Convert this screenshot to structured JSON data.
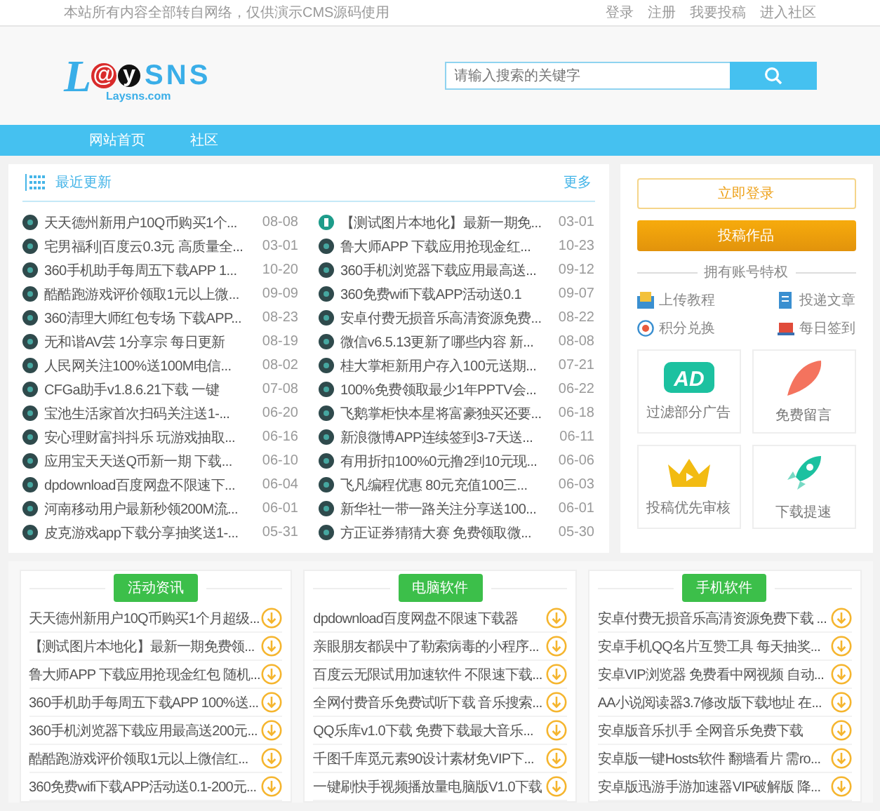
{
  "topbar": {
    "notice": "本站所有内容全部转自网络，仅供演示CMS源码使用",
    "links": [
      "登录",
      "注册",
      "我要投稿",
      "进入社区"
    ]
  },
  "logo": {
    "mark": [
      "L",
      "@",
      "y"
    ],
    "name": "SNS",
    "domain": "Laysns.com"
  },
  "search": {
    "placeholder": "请输入搜索的关键字"
  },
  "nav": [
    "网站首页",
    "社区"
  ],
  "recent": {
    "title": "最近更新",
    "more": "更多",
    "items": [
      {
        "title": "天天德州新用户10Q币购买1个...",
        "date": "08-08",
        "kind": "dot"
      },
      {
        "title": "【测试图片本地化】最新一期免...",
        "date": "03-01",
        "kind": "image"
      },
      {
        "title": "宅男福利|百度云0.3元 高质量全...",
        "date": "03-01",
        "kind": "dot"
      },
      {
        "title": "鲁大师APP 下载应用抢现金红...",
        "date": "10-23",
        "kind": "dot"
      },
      {
        "title": "360手机助手每周五下载APP 1...",
        "date": "10-20",
        "kind": "dot"
      },
      {
        "title": "360手机浏览器下载应用最高送...",
        "date": "09-12",
        "kind": "dot"
      },
      {
        "title": "酷酷跑游戏评价领取1元以上微...",
        "date": "09-09",
        "kind": "dot"
      },
      {
        "title": "360免费wifi下载APP活动送0.1",
        "date": "09-07",
        "kind": "dot"
      },
      {
        "title": "360清理大师红包专场 下载APP...",
        "date": "08-23",
        "kind": "dot"
      },
      {
        "title": "安卓付费无损音乐高清资源免费...",
        "date": "08-22",
        "kind": "dot"
      },
      {
        "title": "无和谐AV芸 1分享宗 每日更新",
        "date": "08-19",
        "kind": "dot"
      },
      {
        "title": "微信v6.5.13更新了哪些内容 新...",
        "date": "08-08",
        "kind": "dot"
      },
      {
        "title": "人民网关注100%送100M电信...",
        "date": "08-02",
        "kind": "dot"
      },
      {
        "title": "桂大掌柜新用户存入100元送期...",
        "date": "07-21",
        "kind": "dot"
      },
      {
        "title": "CFGa助手v1.8.6.21下载 一键",
        "date": "07-08",
        "kind": "dot"
      },
      {
        "title": "100%免费领取最少1年PPTV会...",
        "date": "06-22",
        "kind": "dot"
      },
      {
        "title": "宝池生活家首次扫码关注送1-...",
        "date": "06-20",
        "kind": "dot"
      },
      {
        "title": "飞鹅掌柜快本星将富豪独买还要...",
        "date": "06-18",
        "kind": "dot"
      },
      {
        "title": "安心理财富抖抖乐 玩游戏抽取...",
        "date": "06-16",
        "kind": "dot"
      },
      {
        "title": "新浪微博APP连续签到3-7天送...",
        "date": "06-11",
        "kind": "dot"
      },
      {
        "title": "应用宝天天送Q币新一期 下载...",
        "date": "06-10",
        "kind": "dot"
      },
      {
        "title": "有用折扣100%0元撸2到10元现...",
        "date": "06-06",
        "kind": "dot"
      },
      {
        "title": "dpdownload百度网盘不限速下...",
        "date": "06-04",
        "kind": "dot"
      },
      {
        "title": "飞凡编程优惠 80元充值100三...",
        "date": "06-03",
        "kind": "dot"
      },
      {
        "title": "河南移动用户最新秒领200M流...",
        "date": "06-01",
        "kind": "dot"
      },
      {
        "title": "新华社一带一路关注分享送100...",
        "date": "06-01",
        "kind": "dot"
      },
      {
        "title": "皮克游戏app下载分享抽奖送1-...",
        "date": "05-31",
        "kind": "dot"
      },
      {
        "title": "方正证券猜猜大赛 免费领取微...",
        "date": "05-30",
        "kind": "dot"
      }
    ]
  },
  "account": {
    "login": "立即登录",
    "submit": "投稿作品",
    "divider": "拥有账号特权",
    "links": [
      {
        "label": "上传教程",
        "kind": "upload"
      },
      {
        "label": "投递文章",
        "kind": "document"
      },
      {
        "label": "积分兑换",
        "kind": "points"
      },
      {
        "label": "每日签到",
        "kind": "laptop"
      }
    ],
    "perks": [
      {
        "label": "过滤部分广告",
        "kind": "ad",
        "badge": "AD"
      },
      {
        "label": "免费留言",
        "kind": "feather"
      },
      {
        "label": "投稿优先审核",
        "kind": "crown"
      },
      {
        "label": "下载提速",
        "kind": "rocket"
      }
    ]
  },
  "sections": [
    {
      "title": "活动资讯",
      "items": [
        "天天德州新用户10Q币购买1个月超级...",
        "【测试图片本地化】最新一期免费领...",
        "鲁大师APP 下载应用抢现金红包 随机...",
        "360手机助手每周五下载APP 100%送...",
        "360手机浏览器下载应用最高送200元...",
        "酷酷跑游戏评价领取1元以上微信红...",
        "360免费wifi下载APP活动送0.1-200元..."
      ]
    },
    {
      "title": "电脑软件",
      "items": [
        "dpdownload百度网盘不限速下载器",
        "亲眼朋友都误中了勒索病毒的小程序...",
        "百度云无限试用加速软件 不限速下载...",
        "全网付费音乐免费试听下载 音乐搜索...",
        "QQ乐库v1.0下载 免费下载最大音乐...",
        "千图千库觅元素90设计素材免VIP下...",
        "一键刷快手视频播放量电脑版V1.0下载"
      ]
    },
    {
      "title": "手机软件",
      "items": [
        "安卓付费无损音乐高清资源免费下载 ...",
        "安卓手机QQ名片互赞工具 每天抽奖...",
        "安卓VIP浏览器 免费看中网视频 自动...",
        "AA小说阅读器3.7修改版下载地址 在...",
        "安卓版音乐扒手 全网音乐免费下载",
        "安卓版一键Hosts软件 翻墙看片 需ro...",
        "安卓版迅游手游加速器VIP破解版 降..."
      ]
    }
  ]
}
